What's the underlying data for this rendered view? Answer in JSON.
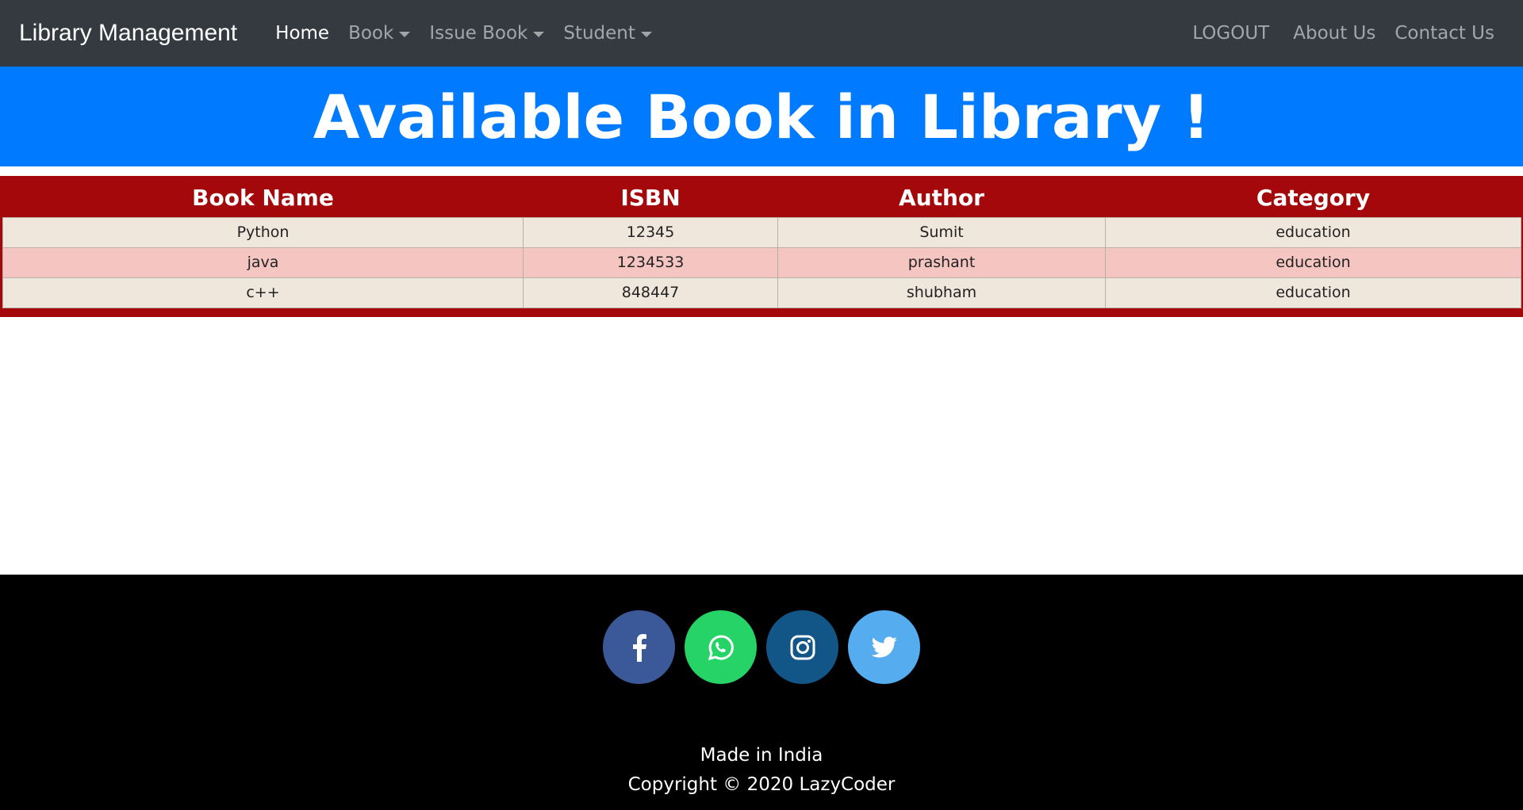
{
  "navbar": {
    "brand": "Library Management",
    "left_items": [
      {
        "label": "Home",
        "active": true,
        "dropdown": false
      },
      {
        "label": "Book",
        "active": false,
        "dropdown": true
      },
      {
        "label": "Issue Book",
        "active": false,
        "dropdown": true
      },
      {
        "label": "Student",
        "active": false,
        "dropdown": true
      }
    ],
    "right_items": [
      {
        "label": "LOGOUT"
      },
      {
        "label": "About Us"
      },
      {
        "label": "Contact Us"
      }
    ]
  },
  "banner": {
    "title": "Available Book in Library !"
  },
  "table": {
    "headers": [
      "Book Name",
      "ISBN",
      "Author",
      "Category"
    ],
    "rows": [
      [
        "Python",
        "12345",
        "Sumit",
        "education"
      ],
      [
        "java",
        "1234533",
        "prashant",
        "education"
      ],
      [
        "c++",
        "848447",
        "shubham",
        "education"
      ]
    ]
  },
  "footer": {
    "social": [
      {
        "icon": "facebook-icon",
        "color": "#3b5998"
      },
      {
        "icon": "whatsapp-icon",
        "color": "#25d366"
      },
      {
        "icon": "instagram-icon",
        "color": "#125688"
      },
      {
        "icon": "twitter-icon",
        "color": "#55acee"
      }
    ],
    "made_in": "Made in India",
    "copyright": "Copyright © 2020 LazyCoder"
  },
  "colors": {
    "navbar_bg": "#343a40",
    "banner_bg": "#007bff",
    "table_header_bg": "#a4080b",
    "row_light": "#efe6dc",
    "row_pink": "#f5c6c1",
    "footer_bg": "#000000"
  }
}
